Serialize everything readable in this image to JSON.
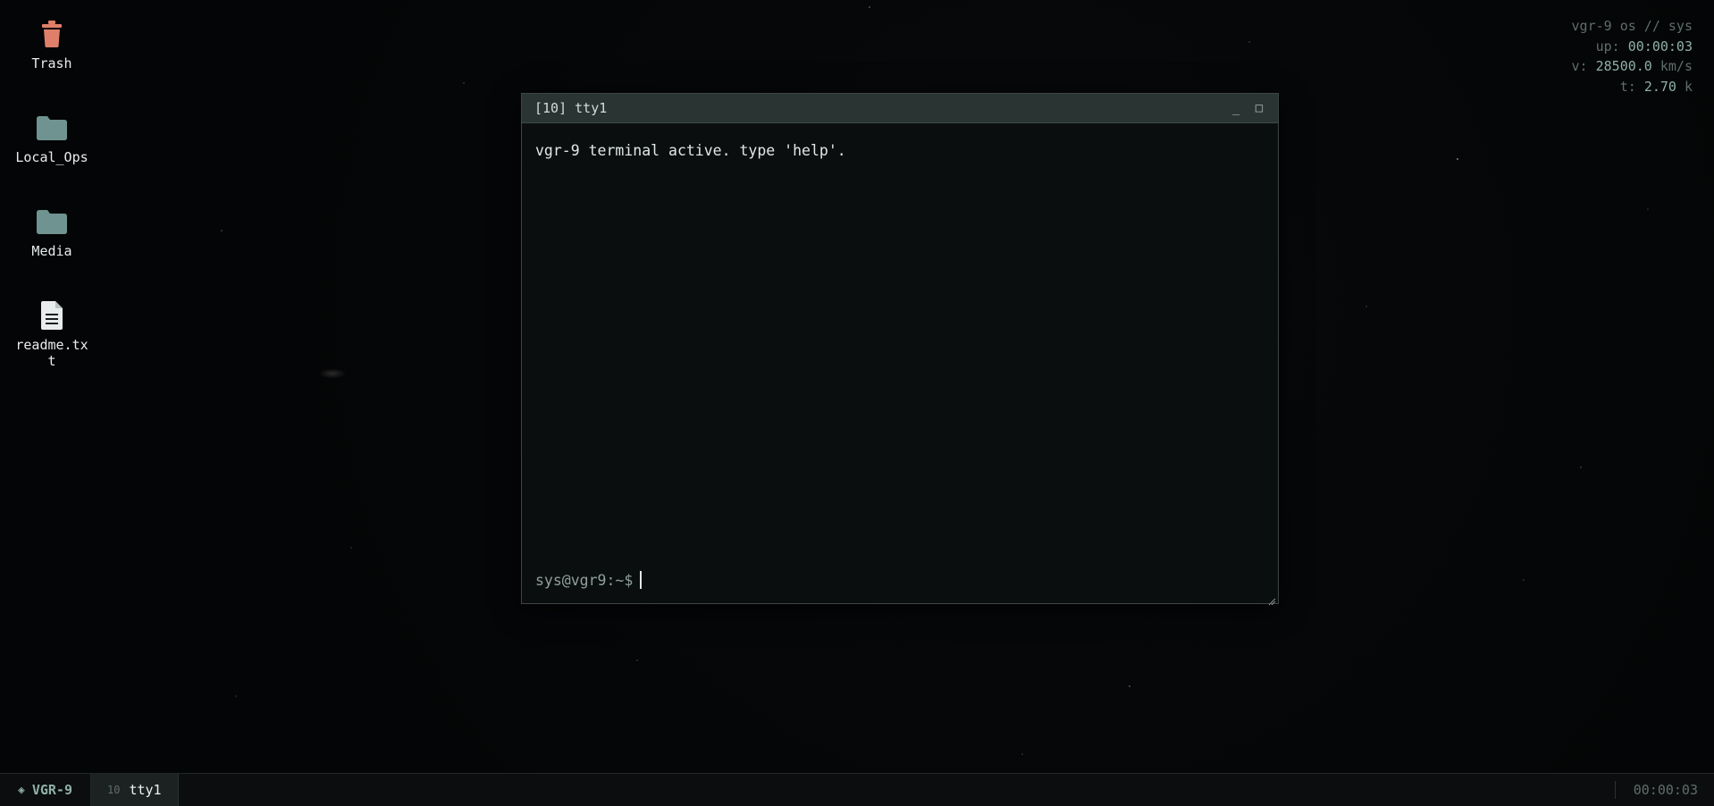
{
  "desktop": {
    "icons": [
      {
        "label": "Trash",
        "icon": "trash-icon",
        "color": "#e07f69"
      },
      {
        "label": "Local_Ops",
        "icon": "folder-icon",
        "color": "#6f9390"
      },
      {
        "label": "Media",
        "icon": "folder-icon",
        "color": "#6f9390"
      },
      {
        "label": "readme.txt",
        "icon": "document-icon",
        "color": "#e8ecec"
      }
    ]
  },
  "sysinfo": {
    "line1": "vgr-9 os // sys",
    "up_label": "up: ",
    "up_value": "00:00:03",
    "v_label": "v: ",
    "v_value": "28500.0",
    "v_unit": " km/s",
    "t_label": "t: ",
    "t_value": "2.70",
    "t_unit": " k"
  },
  "terminal": {
    "title": "[10] tty1",
    "minimize_label": "_",
    "maximize_label": "□",
    "output": "vgr-9 terminal active. type 'help'.",
    "prompt": "sys@vgr9:~$",
    "input_value": ""
  },
  "taskbar": {
    "start_glyph": "◈",
    "start_label": "VGR-9",
    "tasks": [
      {
        "num": "10",
        "name": "tty1"
      }
    ],
    "clock": "00:00:03"
  },
  "colors": {
    "accent": "#8fb0a8",
    "trash": "#e07f69",
    "folder": "#6f9390"
  }
}
